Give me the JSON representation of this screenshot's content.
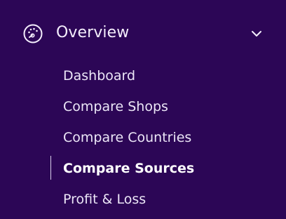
{
  "section": {
    "label": "Overview",
    "icon": "dashboard-gauge-icon",
    "expand_icon": "chevron-down-icon",
    "expanded": true
  },
  "nav": {
    "items": [
      {
        "label": "Dashboard",
        "active": false
      },
      {
        "label": "Compare Shops",
        "active": false
      },
      {
        "label": "Compare Countries",
        "active": false
      },
      {
        "label": "Compare Sources",
        "active": true
      },
      {
        "label": "Profit & Loss",
        "active": false
      }
    ]
  },
  "colors": {
    "background": "#2c0656",
    "text": "#ece6f7",
    "active_indicator": "#d9cfea"
  }
}
